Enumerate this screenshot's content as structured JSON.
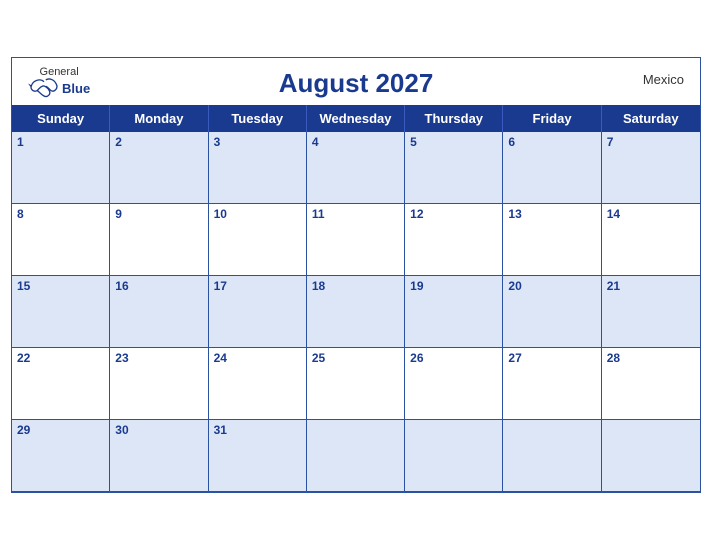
{
  "header": {
    "brand_general": "General",
    "brand_blue": "Blue",
    "title": "August 2027",
    "country": "Mexico"
  },
  "days_of_week": [
    "Sunday",
    "Monday",
    "Tuesday",
    "Wednesday",
    "Thursday",
    "Friday",
    "Saturday"
  ],
  "weeks": [
    [
      {
        "num": "1",
        "empty": false
      },
      {
        "num": "2",
        "empty": false
      },
      {
        "num": "3",
        "empty": false
      },
      {
        "num": "4",
        "empty": false
      },
      {
        "num": "5",
        "empty": false
      },
      {
        "num": "6",
        "empty": false
      },
      {
        "num": "7",
        "empty": false
      }
    ],
    [
      {
        "num": "8",
        "empty": false
      },
      {
        "num": "9",
        "empty": false
      },
      {
        "num": "10",
        "empty": false
      },
      {
        "num": "11",
        "empty": false
      },
      {
        "num": "12",
        "empty": false
      },
      {
        "num": "13",
        "empty": false
      },
      {
        "num": "14",
        "empty": false
      }
    ],
    [
      {
        "num": "15",
        "empty": false
      },
      {
        "num": "16",
        "empty": false
      },
      {
        "num": "17",
        "empty": false
      },
      {
        "num": "18",
        "empty": false
      },
      {
        "num": "19",
        "empty": false
      },
      {
        "num": "20",
        "empty": false
      },
      {
        "num": "21",
        "empty": false
      }
    ],
    [
      {
        "num": "22",
        "empty": false
      },
      {
        "num": "23",
        "empty": false
      },
      {
        "num": "24",
        "empty": false
      },
      {
        "num": "25",
        "empty": false
      },
      {
        "num": "26",
        "empty": false
      },
      {
        "num": "27",
        "empty": false
      },
      {
        "num": "28",
        "empty": false
      }
    ],
    [
      {
        "num": "29",
        "empty": false
      },
      {
        "num": "30",
        "empty": false
      },
      {
        "num": "31",
        "empty": false
      },
      {
        "num": "",
        "empty": true
      },
      {
        "num": "",
        "empty": true
      },
      {
        "num": "",
        "empty": true
      },
      {
        "num": "",
        "empty": true
      }
    ]
  ],
  "colors": {
    "blue_dark": "#1a3a8f",
    "blue_light": "#dce6f7",
    "border": "#2a52a0"
  }
}
